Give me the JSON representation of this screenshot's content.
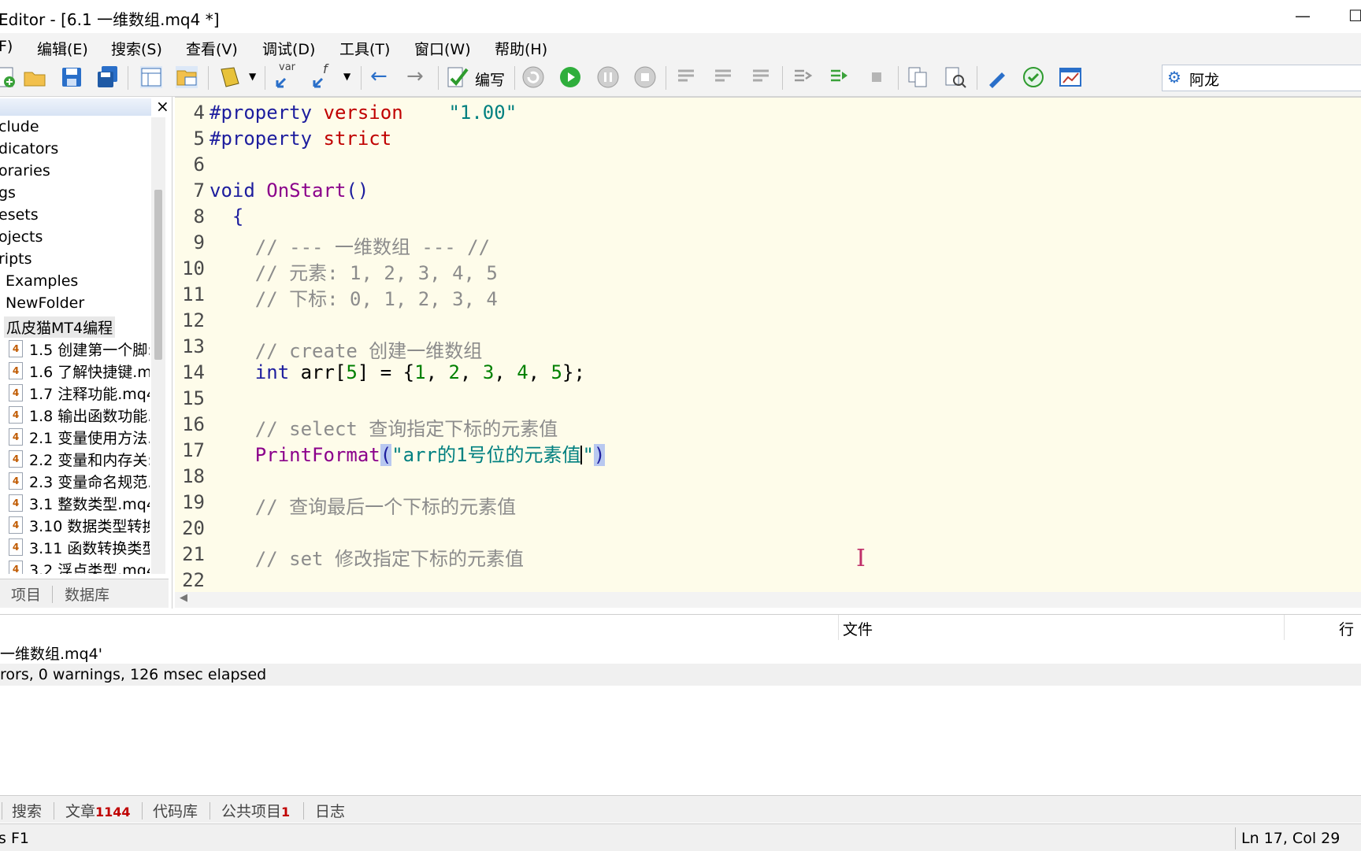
{
  "window": {
    "title": "Editor - [6.1 一维数组.mq4 *]"
  },
  "menu": [
    "F)",
    "编辑(E)",
    "搜索(S)",
    "查看(V)",
    "调试(D)",
    "工具(T)",
    "窗口(W)",
    "帮助(H)"
  ],
  "toolbar": {
    "compile_label": "编写",
    "search_value": "阿龙",
    "var_label": "var",
    "f_label": "f"
  },
  "navigator": {
    "folders": [
      "clude",
      "dicators",
      "oraries",
      "gs",
      "esets",
      "ojects",
      "ripts"
    ],
    "subfolders": [
      "Examples",
      "NewFolder",
      "瓜皮猫MT4编程"
    ],
    "files": [
      "1.5 创建第一个脚:",
      "1.6 了解快捷键.m",
      "1.7 注释功能.mq4",
      "1.8 输出函数功能.",
      "2.1 变量使用方法.",
      "2.2 变量和内存关:",
      "2.3 变量命名规范.",
      "3.1 整数类型.mq4",
      "3.10 数据类型转换",
      "3.11 函数转换类型",
      "3.2 浮点类型.mq4"
    ],
    "file_icon": "4",
    "tabs": [
      "项目",
      "数据库"
    ]
  },
  "editor": {
    "line_numbers": [
      "4",
      "5",
      "6",
      "7",
      "8",
      "9",
      "10",
      "11",
      "12",
      "13",
      "14",
      "15",
      "16",
      "17",
      "18",
      "19",
      "20",
      "21",
      "22"
    ],
    "code": {
      "l4_a": "#property",
      "l4_b": "version",
      "l4_c": "\"1.00\"",
      "l5_a": "#property",
      "l5_b": "strict",
      "l7_a": "void",
      "l7_b": "OnStart",
      "l7_c": "()",
      "l8": "{",
      "l9": "// --- 一维数组 --- //",
      "l10": "// 元素: 1, 2, 3, 4, 5",
      "l11": "// 下标: 0, 1, 2, 3, 4",
      "l13": "// create 创建一维数组",
      "l14_int": "int",
      "l14_arr": "arr[",
      "l14_5": "5",
      "l14_b": "] = {",
      "l14_v1": "1",
      "l14_v2": "2",
      "l14_v3": "3",
      "l14_v4": "4",
      "l14_v5": "5",
      "l14_end": "};",
      "l16": "// select 查询指定下标的元素值",
      "l17_fn": "PrintFormat",
      "l17_p1": "(",
      "l17_str": "\"arr的1号位的元素值",
      "l17_q": "\"",
      "l17_p2": ")",
      "l19": "// 查询最后一个下标的元素值",
      "l21": "// set 修改指定下标的元素值"
    }
  },
  "toolbox": {
    "header_file": "文件",
    "header_line": "行",
    "rows": [
      "一维数组.mq4'",
      "rors, 0 warnings, 126 msec elapsed"
    ]
  },
  "bottom_tabs": [
    {
      "label": "搜索",
      "count": ""
    },
    {
      "label": "文章",
      "count": "1144"
    },
    {
      "label": "代码库",
      "count": ""
    },
    {
      "label": "公共项目",
      "count": "1"
    },
    {
      "label": "日志",
      "count": ""
    }
  ],
  "status": {
    "help": "s F1",
    "position": "Ln 17, Col 29"
  }
}
